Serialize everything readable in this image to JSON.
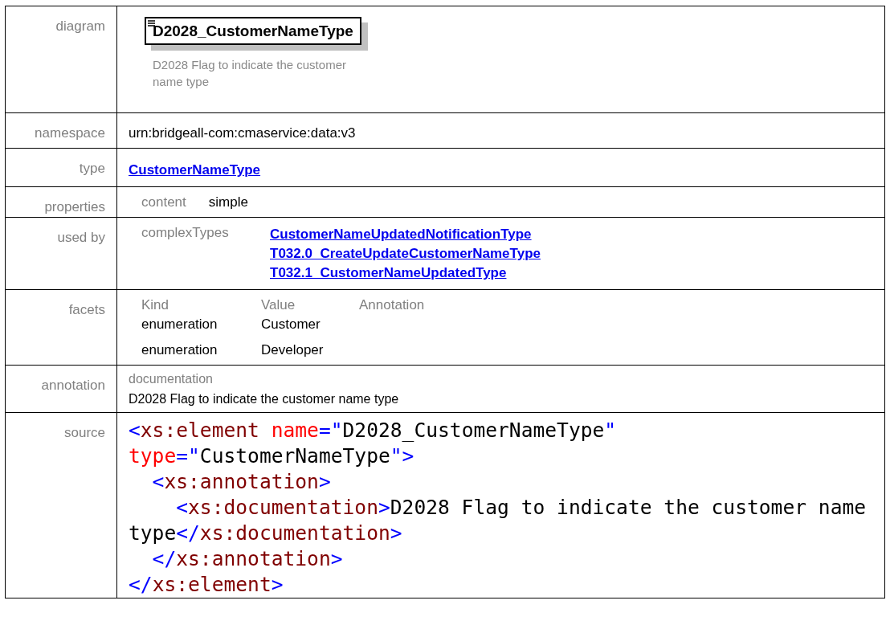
{
  "diagram": {
    "label": "diagram",
    "element_name": "D2028_CustomerNameType",
    "description": "D2028 Flag to indicate the customer name type"
  },
  "namespace": {
    "label": "namespace",
    "value": "urn:bridgeall-com:cmaservice:data:v3"
  },
  "type": {
    "label": "type",
    "link": "CustomerNameType"
  },
  "properties": {
    "label": "properties",
    "items": [
      {
        "name": "content",
        "value": "simple"
      }
    ]
  },
  "used_by": {
    "label": "used by",
    "category": "complexTypes",
    "links": [
      "CustomerNameUpdatedNotificationType",
      "T032.0_CreateUpdateCustomerNameType",
      "T032.1_CustomerNameUpdatedType"
    ]
  },
  "facets": {
    "label": "facets",
    "columns": [
      "Kind",
      "Value",
      "Annotation"
    ],
    "rows": [
      {
        "kind": "enumeration",
        "value": "Customer"
      },
      {
        "kind": "enumeration",
        "value": "Developer"
      }
    ]
  },
  "annotation": {
    "label": "annotation",
    "heading": "documentation",
    "text": "D2028 Flag to indicate the customer name type"
  },
  "source": {
    "label": "source",
    "lines": [
      [
        {
          "kind": "punct",
          "text": "<"
        },
        {
          "kind": "tag",
          "text": "xs:element"
        },
        {
          "kind": "attr",
          "text": " name"
        },
        {
          "kind": "punct",
          "text": "=\""
        },
        {
          "kind": "value",
          "text": "D2028_CustomerNameType"
        },
        {
          "kind": "punct",
          "text": "\""
        }
      ],
      [
        {
          "kind": "attr",
          "text": "type"
        },
        {
          "kind": "punct",
          "text": "=\""
        },
        {
          "kind": "value",
          "text": "CustomerNameType"
        },
        {
          "kind": "punct",
          "text": "\">"
        }
      ],
      [
        {
          "kind": "punct",
          "text": "  <"
        },
        {
          "kind": "tag",
          "text": "xs:annotation"
        },
        {
          "kind": "punct",
          "text": ">"
        }
      ],
      [
        {
          "kind": "punct",
          "text": "    <"
        },
        {
          "kind": "tag",
          "text": "xs:documentation"
        },
        {
          "kind": "punct",
          "text": ">"
        },
        {
          "kind": "value",
          "text": "D2028 Flag to indicate the customer name"
        }
      ],
      [
        {
          "kind": "value",
          "text": "type"
        },
        {
          "kind": "punct",
          "text": "</"
        },
        {
          "kind": "tag",
          "text": "xs:documentation"
        },
        {
          "kind": "punct",
          "text": ">"
        }
      ],
      [
        {
          "kind": "punct",
          "text": "  </"
        },
        {
          "kind": "tag",
          "text": "xs:annotation"
        },
        {
          "kind": "punct",
          "text": ">"
        }
      ],
      [
        {
          "kind": "punct",
          "text": "</"
        },
        {
          "kind": "tag",
          "text": "xs:element"
        },
        {
          "kind": "punct",
          "text": ">"
        }
      ]
    ]
  }
}
